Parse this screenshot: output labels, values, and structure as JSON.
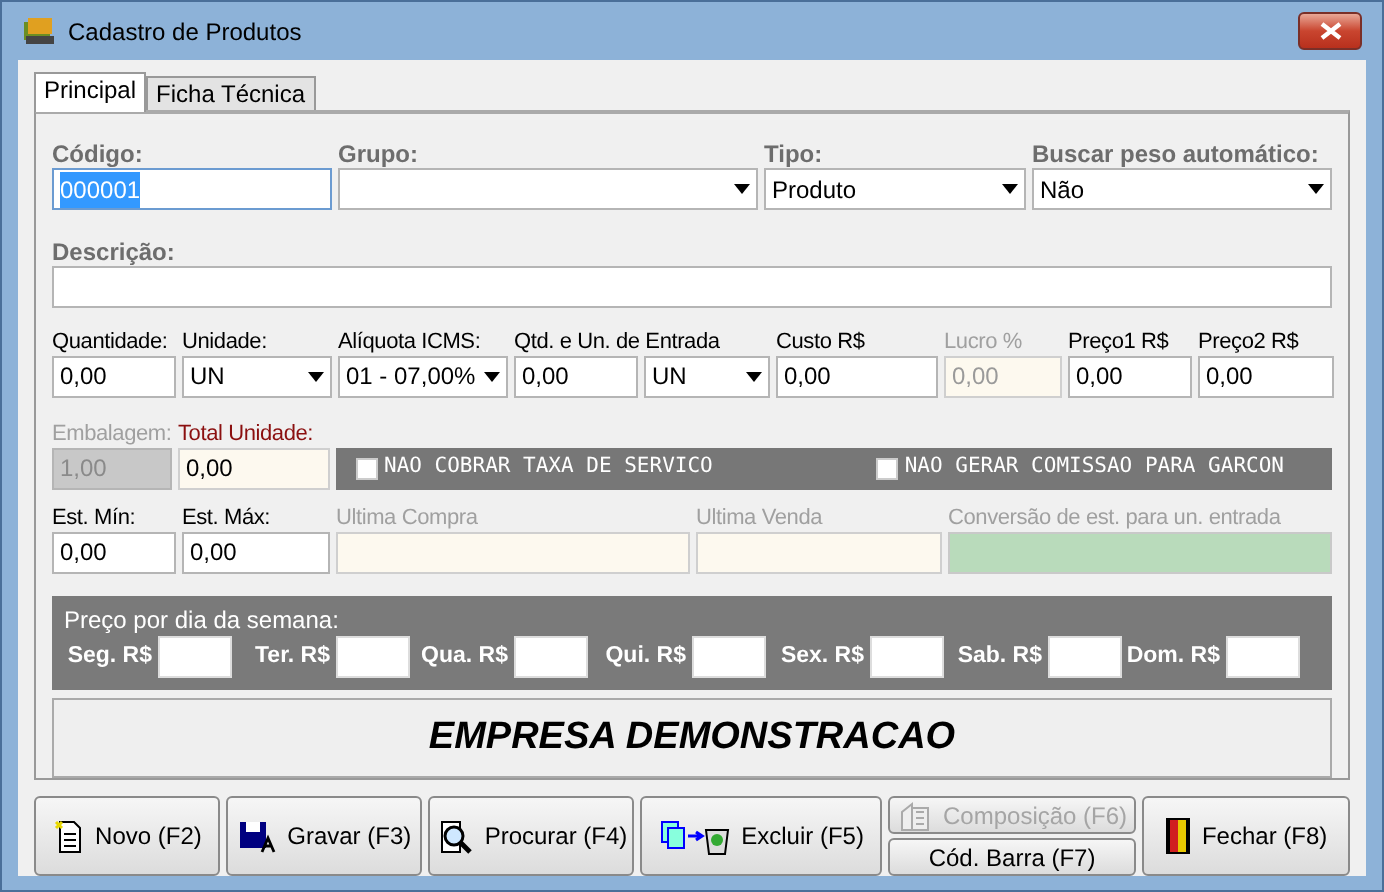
{
  "window": {
    "title": "Cadastro de Produtos"
  },
  "tabs": [
    {
      "label": "Principal",
      "selected": true
    },
    {
      "label": "Ficha Técnica",
      "selected": false
    }
  ],
  "rows": [
    [
      {
        "kind": "input",
        "label": "Código:",
        "value": "000001",
        "focused": true
      },
      {
        "kind": "select",
        "label": "Grupo:"
      },
      {
        "kind": "select",
        "label": "Tipo:",
        "value": "Produto"
      },
      {
        "kind": "select",
        "label": "Buscar peso automático:",
        "value": "Não"
      }
    ],
    [
      {
        "kind": "input",
        "label": "Descrição:"
      }
    ],
    [
      {
        "kind": "input",
        "label": "Quantidade:",
        "value": "0,00"
      },
      {
        "kind": "select",
        "label": "Unidade:",
        "value": "UN"
      },
      {
        "kind": "select",
        "label": "Alíquota ICMS:",
        "value": "01 - 07,00%"
      },
      {
        "kind": "input",
        "label": "Qtd. e Un. de Entrada",
        "value": "0,00"
      },
      {
        "kind": "select",
        "value": "UN"
      },
      {
        "kind": "input",
        "label": "Custo R$",
        "value": "0,00"
      },
      {
        "kind": "input",
        "label": "Lucro %",
        "value": "0,00",
        "readonly": true,
        "disabled": true
      },
      {
        "kind": "input",
        "label": "Preço1 R$",
        "value": "0,00"
      },
      {
        "kind": "input",
        "label": "Preço2 R$",
        "value": "0,00"
      }
    ],
    [
      {
        "kind": "input",
        "label": "Embalagem:",
        "value": "1,00",
        "disabled": true
      },
      {
        "kind": "input",
        "label": "Total Unidade:",
        "value": "0,00",
        "readonly": true,
        "alert": true
      },
      {
        "kind": "options",
        "items": [
          {
            "label": "NAO COBRAR TAXA DE SERVICO",
            "checked": false
          },
          {
            "label": "NAO GERAR COMISSAO PARA GARCON",
            "checked": false
          }
        ]
      }
    ],
    [
      {
        "kind": "input",
        "label": "Est. Mín:",
        "value": "0,00"
      },
      {
        "kind": "input",
        "label": "Est. Máx:",
        "value": "0,00"
      },
      {
        "kind": "input",
        "label": "Ultima Compra",
        "readonly": true,
        "disabled": true
      },
      {
        "kind": "input",
        "label": "Ultima Venda",
        "readonly": true,
        "disabled": true
      },
      {
        "kind": "indicator",
        "label": "Conversão de est. para un. entrada",
        "disabled": true
      }
    ]
  ],
  "weekday_prices": {
    "title": "Preço por dia da semana:",
    "days": [
      {
        "label": "Seg. R$"
      },
      {
        "label": "Ter. R$"
      },
      {
        "label": "Qua. R$"
      },
      {
        "label": "Qui. R$"
      },
      {
        "label": "Sex. R$"
      },
      {
        "label": "Sab. R$"
      },
      {
        "label": "Dom. R$"
      }
    ]
  },
  "company_banner": "EMPRESA DEMONSTRACAO",
  "buttons": [
    {
      "kind": "new",
      "label": "Novo (F2)",
      "disabled": false
    },
    {
      "kind": "save",
      "label": "Gravar (F3)",
      "disabled": false
    },
    {
      "kind": "search",
      "label": "Procurar (F4)",
      "disabled": false
    },
    {
      "kind": "delete",
      "label": "Excluir (F5)",
      "disabled": false
    },
    {
      "kind": "stack",
      "items": [
        {
          "kind": "composition",
          "label": "Composição (F6)",
          "disabled": true
        },
        {
          "kind": "plain",
          "label": "Cód. Barra (F7)",
          "disabled": false
        }
      ]
    },
    {
      "kind": "close",
      "label": "Fechar (F8)",
      "disabled": false
    }
  ]
}
